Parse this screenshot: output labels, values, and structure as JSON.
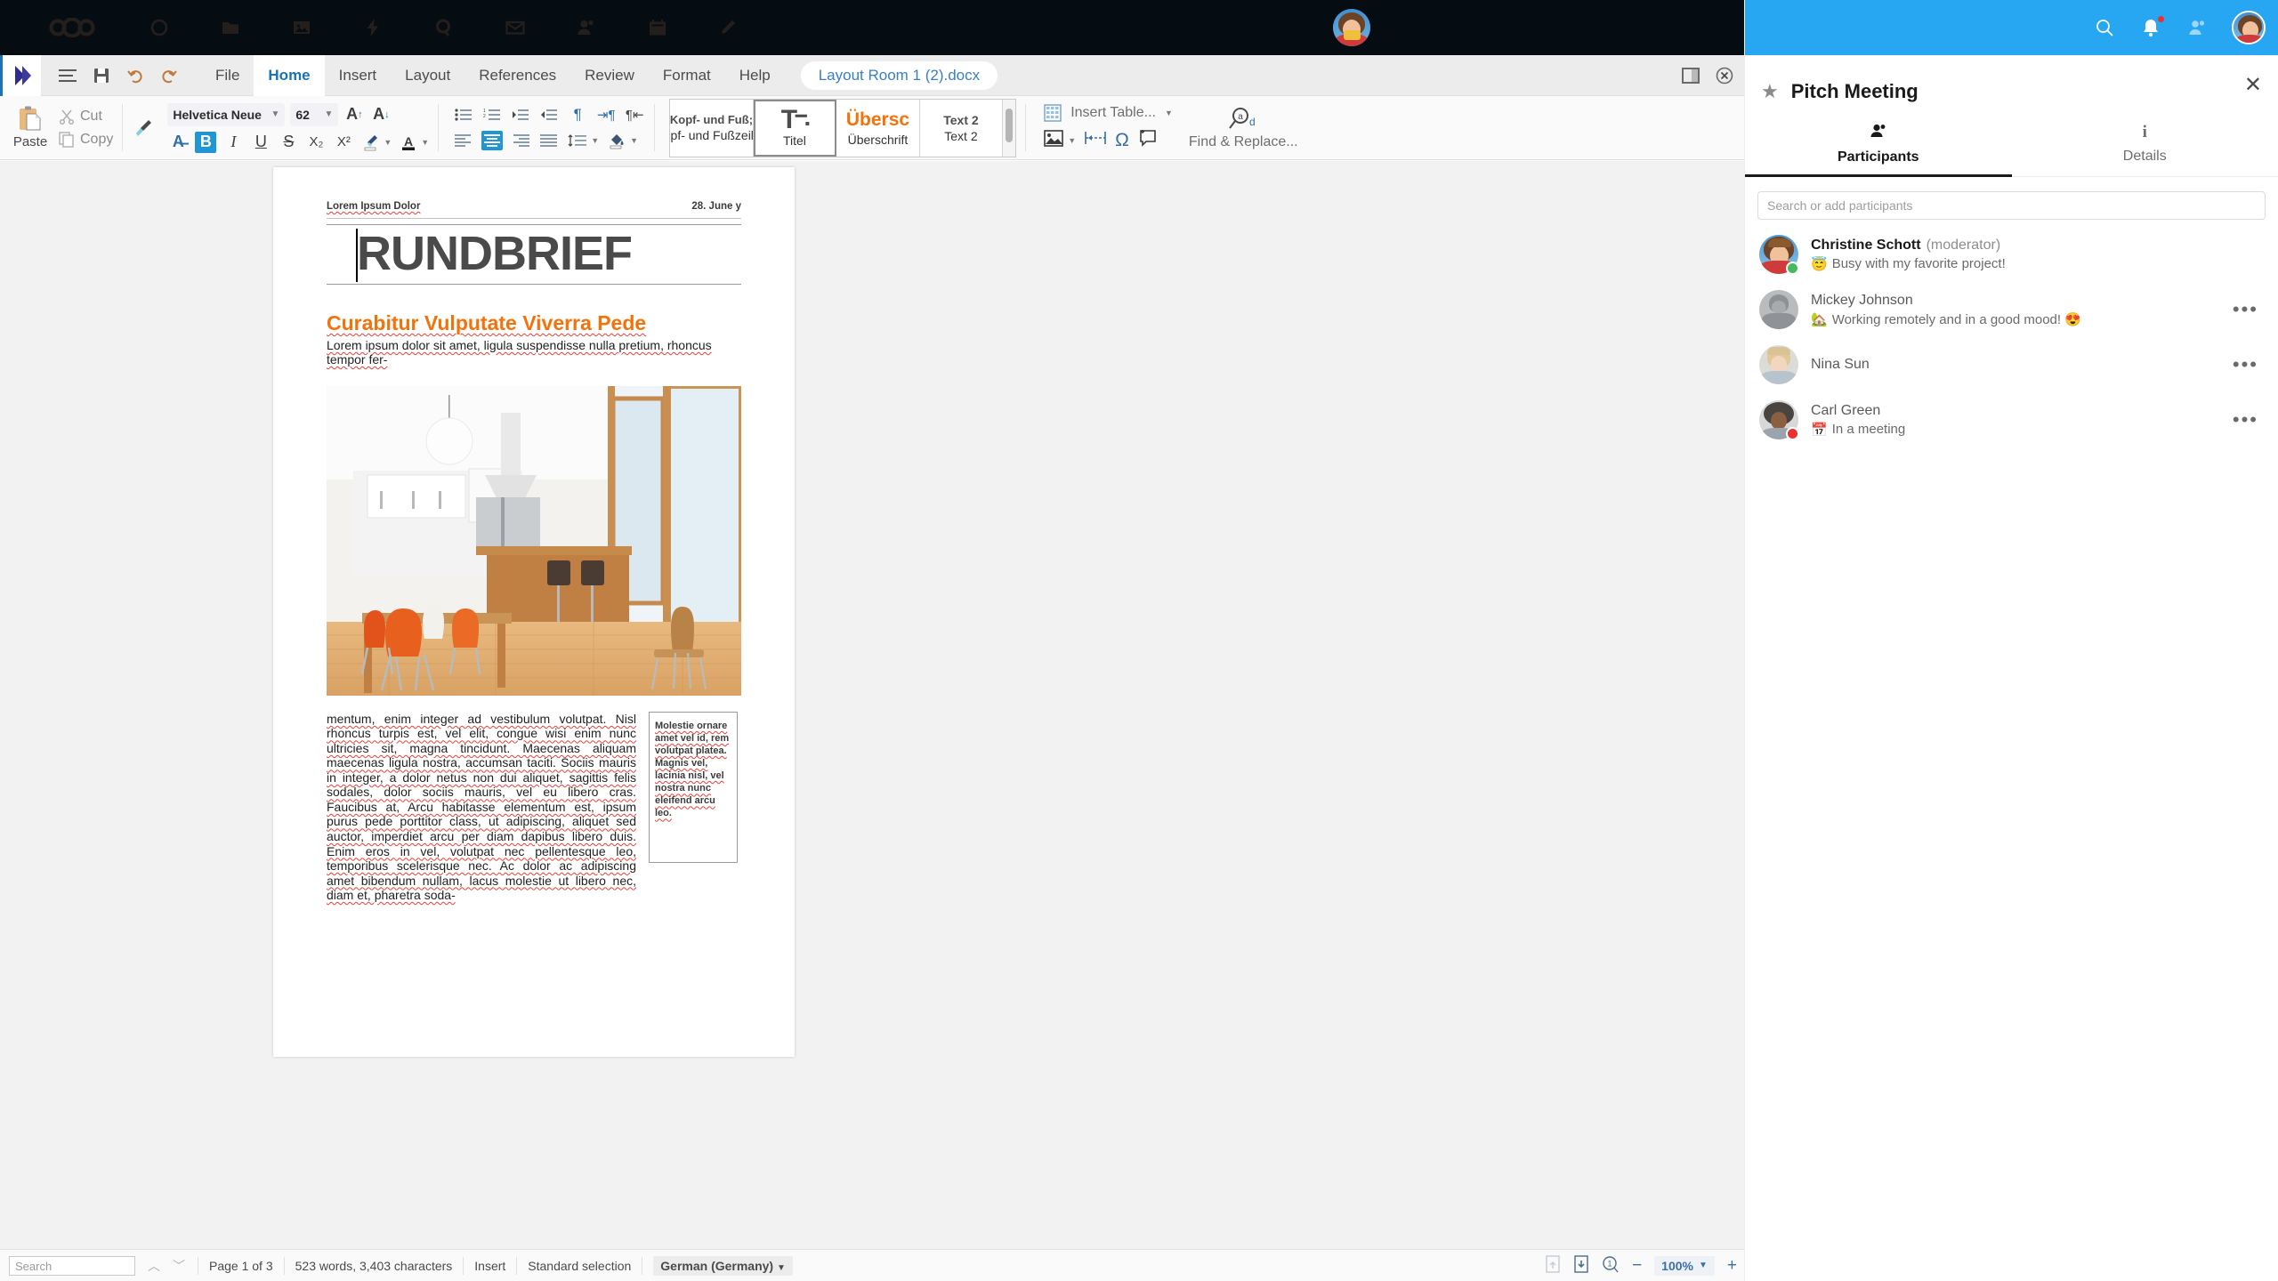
{
  "nextcloud_bar": {
    "logo_name": "nextcloud-logo",
    "apps": [
      {
        "name": "dashboard-icon",
        "glyph": "circle"
      },
      {
        "name": "files-icon",
        "glyph": "folder"
      },
      {
        "name": "photos-icon",
        "glyph": "image"
      },
      {
        "name": "activity-icon",
        "glyph": "bolt"
      },
      {
        "name": "search-app-icon",
        "glyph": "magnifier"
      },
      {
        "name": "mail-icon",
        "glyph": "envelope"
      },
      {
        "name": "contacts-icon",
        "glyph": "contacts"
      },
      {
        "name": "calendar-icon",
        "glyph": "calendar"
      },
      {
        "name": "notes-icon",
        "glyph": "pencil"
      }
    ],
    "user_avatar": "user-avatar"
  },
  "office": {
    "menubar": {
      "app_icon": "collabora-diamond-icon",
      "quick_icons": [
        {
          "name": "menu-hamburger-icon"
        },
        {
          "name": "save-icon"
        },
        {
          "name": "undo-icon"
        },
        {
          "name": "redo-icon"
        }
      ],
      "menus": [
        {
          "label": "File",
          "active": false
        },
        {
          "label": "Home",
          "active": true
        },
        {
          "label": "Insert",
          "active": false
        },
        {
          "label": "Layout",
          "active": false
        },
        {
          "label": "References",
          "active": false
        },
        {
          "label": "Review",
          "active": false
        },
        {
          "label": "Format",
          "active": false
        },
        {
          "label": "Help",
          "active": false
        }
      ],
      "document_name": "Layout Room 1 (2).docx",
      "window_controls": [
        {
          "name": "toggle-sidebar-icon"
        },
        {
          "name": "close-document-icon"
        }
      ]
    },
    "ribbon": {
      "paste_label": "Paste",
      "cut_label": "Cut",
      "copy_label": "Copy",
      "clone_formatting_icon": "clone-formatting-brush-icon",
      "font_name": "Helvetica Neue",
      "font_size": "62",
      "grow_font_icon": "increase-font-size-icon",
      "shrink_font_icon": "decrease-font-size-icon",
      "clear_formatting_icon": "clear-formatting-icon",
      "bold_label": "B",
      "italic_label": "I",
      "underline_label": "U",
      "strikethrough_label": "S",
      "subscript_label": "X₂",
      "superscript_label": "X²",
      "highlight_icon": "highlight-color-icon",
      "fontcolor_icon": "font-color-icon",
      "styles": [
        {
          "preview": "Kopf- und Fuß;",
          "name": "Kopf- und Fußzeilen",
          "selected": false,
          "kind": "text"
        },
        {
          "preview": "T",
          "name": "Titel",
          "selected": true,
          "kind": "title"
        },
        {
          "preview": "Übersc",
          "name": "Überschrift",
          "selected": false,
          "kind": "heading"
        },
        {
          "preview": "Text 2",
          "name": "Text 2",
          "selected": false,
          "kind": "text2"
        }
      ],
      "insert_table_label": "Insert Table...",
      "insert_image_icon": "insert-image-icon",
      "insert_pagebreak_icon": "insert-page-break-icon",
      "insert_special_char_icon": "special-character-omega-icon",
      "insert_comment_icon": "insert-comment-icon",
      "find_replace_label": "Find & Replace..."
    },
    "document": {
      "header_left": "Lorem Ipsum Dolor",
      "header_right": "28. June y",
      "title": "RUNDBRIEF",
      "section_heading": "Curabitur Vulputate Viverra Pede",
      "lead_paragraph": "Lorem ipsum dolor sit amet, ligula suspendisse nulla pretium, rhoncus tempor fer-",
      "image_alt": "modern kitchen dining room with orange chairs",
      "body_text": "mentum, enim integer ad vestibulum volutpat. Nisl rhoncus turpis est, vel elit, congue wisi enim nunc ultricies sit, magna tincidunt. Maecenas aliquam maecenas ligula nostra, accumsan taciti. Sociis mauris in integer, a dolor netus non dui aliquet, sagittis felis sodales, dolor sociis mauris, vel eu libero cras. Faucibus at, Arcu habitasse elementum est, ipsum purus pede porttitor class, ut adipiscing, aliquet sed auctor, imperdiet arcu per diam dapibus libero duis. Enim eros in vel, volutpat nec pellentesque leo, temporibus scelerisque nec. Ac dolor ac adipiscing amet bibendum nullam, lacus molestie ut libero nec, diam et, pharetra soda-",
      "sidebar_text": "Molestie ornare amet vel id, rem volutpat platea. Magnis vel, lacinia nisl, vel nostra nunc eleifend arcu leo."
    },
    "statusbar": {
      "search_placeholder": "Search",
      "prev_icon": "find-previous-icon",
      "next_icon": "find-next-icon",
      "page_info": "Page 1 of 3",
      "word_count": "523 words, 3,403 characters",
      "insert_mode": "Insert",
      "selection_mode": "Standard selection",
      "language": "German (Germany)",
      "save_state_icon": "document-modified-icon",
      "export_icon": "export-document-icon",
      "view_layout_icon": "single-page-view-icon",
      "zoom_out_label": "−",
      "zoom_level": "100%",
      "zoom_in_label": "+"
    }
  },
  "talk": {
    "header_icons": [
      {
        "name": "search-icon"
      },
      {
        "name": "notifications-bell-icon",
        "has_badge": true
      },
      {
        "name": "contacts-icon"
      },
      {
        "name": "user-avatar"
      }
    ],
    "favorite_icon": "star-favorite-icon",
    "title": "Pitch Meeting",
    "close_icon": "close-sidebar-icon",
    "tabs": [
      {
        "label": "Participants",
        "icon": "participants-icon",
        "selected": true
      },
      {
        "label": "Details",
        "icon": "info-icon",
        "selected": false
      }
    ],
    "search_placeholder": "Search or add participants",
    "participants": [
      {
        "name": "Christine Schott",
        "role": "(moderator)",
        "status_emoji": "😇",
        "status_text": "Busy with my favorite project!",
        "presence": "online",
        "presence_color": "#46ba61",
        "has_menu": false,
        "avatar": "christine-avatar"
      },
      {
        "name": "Mickey Johnson",
        "role": "",
        "status_emoji": "🏡",
        "status_text": "Working remotely and in a good mood! 😍",
        "presence": "",
        "presence_color": "",
        "has_menu": true,
        "avatar": "mickey-avatar"
      },
      {
        "name": "Nina Sun",
        "role": "",
        "status_emoji": "",
        "status_text": "",
        "presence": "",
        "presence_color": "",
        "has_menu": true,
        "avatar": "nina-avatar"
      },
      {
        "name": "Carl Green",
        "role": "",
        "status_emoji": "📅",
        "status_text": "In a meeting",
        "presence": "dnd",
        "presence_color": "#e9322d",
        "has_menu": true,
        "avatar": "carl-avatar"
      }
    ],
    "menu_glyph": "•••"
  },
  "colors": {
    "nextcloud_blue": "#27a6f2",
    "topbar_black": "#050d12",
    "accent_orange": "#f4720b",
    "office_blue": "#1b72b5",
    "spell_red": "#e8403a"
  }
}
